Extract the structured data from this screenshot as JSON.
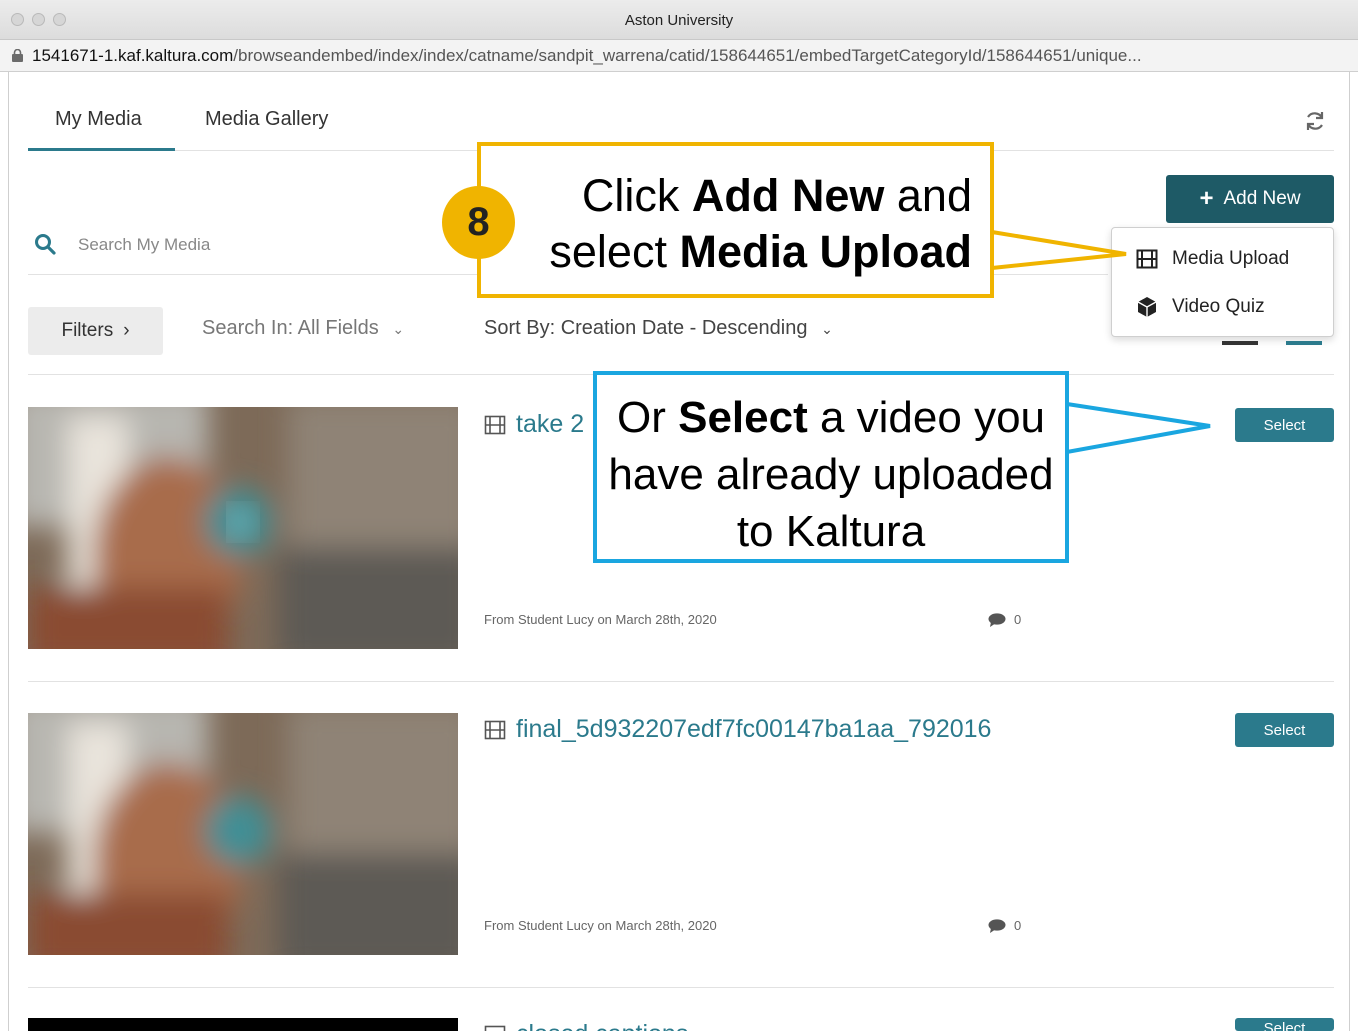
{
  "window": {
    "title": "Aston University",
    "url_host": "1541671-1.kaf.kaltura.com",
    "url_path": "/browseandembed/index/index/catname/sandpit_warrena/catid/158644651/embedTargetCategoryId/158644651/unique..."
  },
  "tabs": [
    {
      "label": "My Media",
      "active": true
    },
    {
      "label": "Media Gallery",
      "active": false
    }
  ],
  "search": {
    "placeholder": "Search My Media",
    "value": ""
  },
  "add_new": {
    "label": "Add New",
    "menu": [
      {
        "label": "Media Upload",
        "icon": "film-icon"
      },
      {
        "label": "Video Quiz",
        "icon": "cube-icon"
      }
    ]
  },
  "filters": {
    "button_label": "Filters",
    "search_in": "Search In: All Fields",
    "sort_by": "Sort By: Creation Date - Descending"
  },
  "entries": [
    {
      "title": "take 2",
      "meta": "From Student Lucy on March 28th, 2020",
      "comments": "0",
      "select_label": "Select"
    },
    {
      "title": "final_5d932207edf7fc00147ba1aa_792016",
      "meta": "From Student Lucy on March 28th, 2020",
      "comments": "0",
      "select_label": "Select"
    },
    {
      "title": "closed captions",
      "select_label": "Select"
    }
  ],
  "callouts": {
    "step_number": "8",
    "add_new_text": {
      "pre": "Click ",
      "bold1": "Add New",
      "mid": " and select ",
      "bold2": "Media Upload"
    },
    "select_text": {
      "pre": "Or ",
      "bold": "Select",
      "post": " a video you have already uploaded to Kaltura"
    }
  },
  "colors": {
    "accent": "#2b7a8c",
    "button_dark": "#1e5a66",
    "callout_orange": "#f0b400",
    "callout_blue": "#1aa6e0"
  }
}
